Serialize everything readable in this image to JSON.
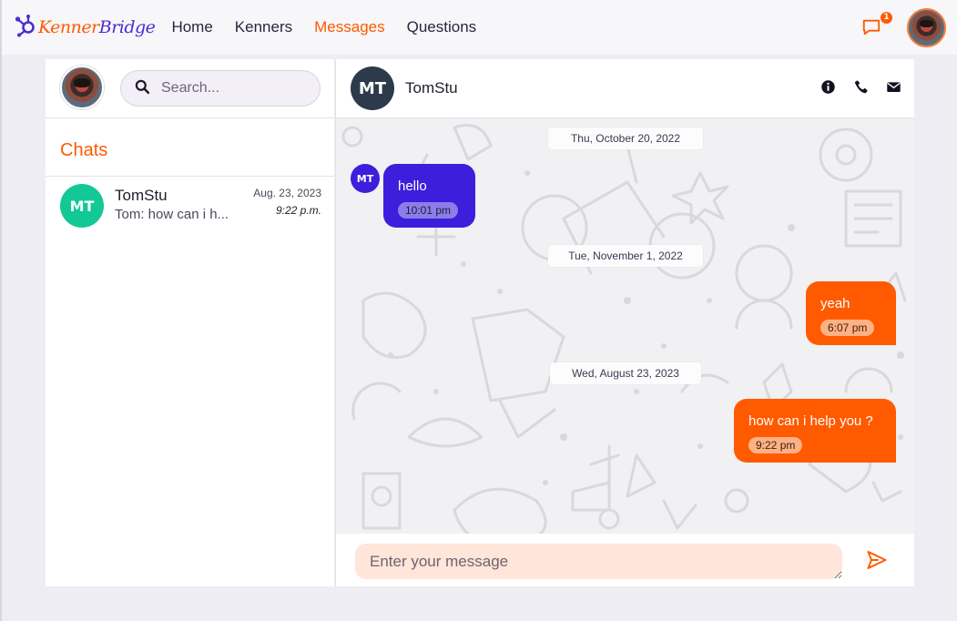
{
  "brand": {
    "name_part1": "Kenner",
    "name_part2": "Bridge"
  },
  "nav": {
    "links": [
      {
        "label": "Home"
      },
      {
        "label": "Kenners"
      },
      {
        "label": "Messages",
        "active": true
      },
      {
        "label": "Questions"
      }
    ],
    "notification_count": "1"
  },
  "sidebar": {
    "search_placeholder": "Search...",
    "chats_title": "Chats",
    "chats": [
      {
        "initials": "MT",
        "name": "TomStu",
        "preview": "Tom: how can i h...",
        "date": "Aug. 23, 2023",
        "time": "9:22 p.m."
      }
    ]
  },
  "conversation": {
    "initials": "MT",
    "name": "TomStu",
    "messages": [
      {
        "type": "date",
        "text": "Thu, October 20, 2022"
      },
      {
        "type": "in",
        "avatar": "MT",
        "text": "hello",
        "time": "10:01 pm"
      },
      {
        "type": "date",
        "text": "Tue, November 1, 2022"
      },
      {
        "type": "out",
        "text": "yeah",
        "time": "6:07 pm"
      },
      {
        "type": "date",
        "text": "Wed, August 23, 2023"
      },
      {
        "type": "out",
        "text": "how can i help you ?",
        "time": "9:22 pm"
      }
    ],
    "composer_placeholder": "Enter your message"
  },
  "icons": {
    "brand": "hubspot-sprocket-icon",
    "notification": "chat-bubble-icon",
    "search": "search-icon",
    "info": "info-circle-icon",
    "phone": "phone-icon",
    "email": "envelope-icon",
    "send": "paper-plane-icon"
  },
  "colors": {
    "accent": "#ff5a00",
    "brand_purple": "#4b2bd6",
    "incoming_bubble": "#3c1edc",
    "chat_avatar": "#12c896",
    "header_avatar": "#2c3a4b"
  }
}
